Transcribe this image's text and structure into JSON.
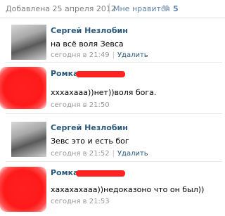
{
  "header": {
    "date": "Добавлена 25 апреля 2012",
    "separator": "|",
    "like_label": "Мне нравится",
    "like_icon": "heart-icon",
    "like_count": "5"
  },
  "comments": [
    {
      "author": "Сергей Незлобин",
      "text": "на всё воля Зевса",
      "time": "сегодня в 21:49",
      "action": "Удалить"
    },
    {
      "author": "Ромка",
      "text": "хххахааа))нет))воля бога.",
      "time": "сегодня в 21:50",
      "action": ""
    },
    {
      "author": "Сергей Незлобин",
      "text": "Зевс это и есть бог",
      "time": "сегодня в 21:52",
      "action": "Удалить"
    },
    {
      "author": "Ромка",
      "text": "хахахахааа))недоказоно что он был))",
      "time": "сегодня в 21:53",
      "action": ""
    }
  ],
  "colors": {
    "link": "#2b587a",
    "meta": "#999999",
    "redaction": "#ff2222"
  }
}
